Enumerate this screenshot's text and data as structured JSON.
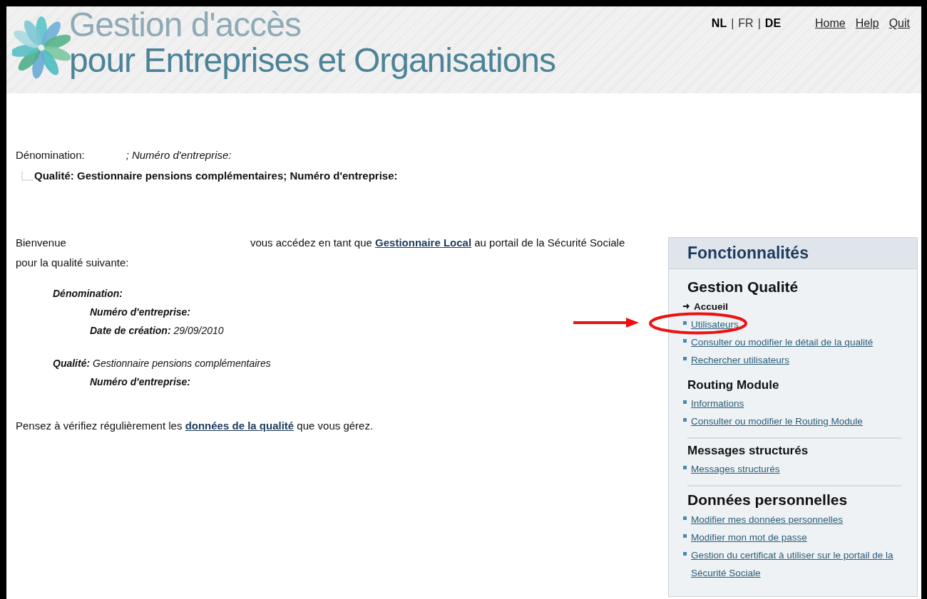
{
  "header": {
    "logo_lines": [
      "Gestion d'accès",
      "pour Entreprises et Organisations"
    ],
    "languages": [
      {
        "label": "NL",
        "selected": true
      },
      {
        "label": "FR",
        "selected": false
      },
      {
        "label": "DE",
        "selected": true
      }
    ],
    "language_separators": [
      "|",
      "|"
    ],
    "links": [
      "Home",
      "Help",
      "Quit"
    ]
  },
  "profile": {
    "name_label": "Dénomination:",
    "separator": ";",
    "number_label": "Numéro d'entreprise:",
    "tree_item": "Qualité: Gestionnaire pensions complémentaires; Numéro d'entreprise:"
  },
  "welcome": {
    "greeting": "Bienvenue",
    "before_link": "vous accédez en tant que",
    "link": "Gestionnaire Local",
    "after_link": "au portail de la Sécurité Sociale pour la qualité suivante:"
  },
  "details": [
    {
      "label": "Dénomination:",
      "children": [
        {
          "label": "Numéro d'entreprise:"
        },
        {
          "label": "Date de création:",
          "value": "29/09/2010"
        }
      ]
    },
    {
      "label": "Qualité:",
      "value": "Gestionnaire pensions complémentaires",
      "children": [
        {
          "label": "Numéro d'entreprise:"
        }
      ]
    }
  ],
  "reminder": {
    "before_link": "Pensez à vérifiez régulièrement les",
    "link": "données de la qualité",
    "after_link": "que vous gérez."
  },
  "sidebar": {
    "title": "Fonctionnalités",
    "sections": [
      {
        "title": "Gestion Qualité",
        "kind": "major",
        "items": [
          {
            "label": "Accueil",
            "selected": true
          },
          {
            "label": "Utilisateurs",
            "selected": false
          },
          {
            "label": "Consulter ou modifier le détail de la qualité",
            "selected": false
          },
          {
            "label": "Rechercher utilisateurs",
            "selected": false
          }
        ]
      },
      {
        "title": "Routing Module",
        "kind": "minor",
        "items": [
          {
            "label": "Informations",
            "selected": false
          },
          {
            "label": "Consulter ou modifier le Routing Module",
            "selected": false
          }
        ]
      },
      {
        "title": "Messages structurés",
        "kind": "minor",
        "items": [
          {
            "label": "Messages structurés",
            "selected": false
          }
        ]
      },
      {
        "title": "Données personnelles",
        "kind": "major",
        "items": [
          {
            "label": "Modifier mes données personnelles",
            "selected": false
          },
          {
            "label": "Modifier mon mot de passe",
            "selected": false
          },
          {
            "label": "Gestion du certificat à utiliser sur le portail de la Sécurité Sociale",
            "selected": false
          }
        ]
      }
    ]
  }
}
